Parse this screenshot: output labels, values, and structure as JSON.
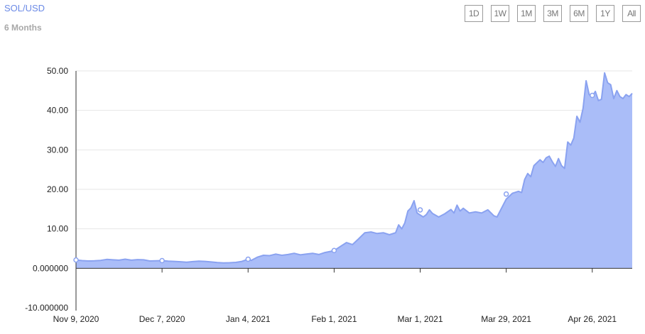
{
  "header": {
    "pair": "SOL/USD",
    "range_label": "6 Months"
  },
  "range_buttons": [
    "1D",
    "1W",
    "1M",
    "3M",
    "6M",
    "1Y",
    "All"
  ],
  "colors": {
    "line": "#8aa2f0",
    "area": "#aabdf8",
    "grid": "#e6e6e6",
    "title": "#6b8ae6"
  },
  "chart_data": {
    "type": "area",
    "title": "",
    "xlabel": "",
    "ylabel": "",
    "ylim": [
      -10,
      50
    ],
    "grid": true,
    "legend": "none",
    "xlim": [
      "2020-11-09",
      "2021-05-09"
    ],
    "x_ticks": [
      {
        "date": "2020-11-09",
        "label": "Nov 9, 2020"
      },
      {
        "date": "2020-12-07",
        "label": "Dec 7, 2020"
      },
      {
        "date": "2021-01-04",
        "label": "Jan 4, 2021"
      },
      {
        "date": "2021-02-01",
        "label": "Feb 1, 2021"
      },
      {
        "date": "2021-03-01",
        "label": "Mar 1, 2021"
      },
      {
        "date": "2021-03-29",
        "label": "Mar 29, 2021"
      },
      {
        "date": "2021-04-26",
        "label": "Apr 26, 2021"
      }
    ],
    "y_ticks": [
      {
        "value": 50,
        "label": "50.00"
      },
      {
        "value": 40,
        "label": "40.00"
      },
      {
        "value": 30,
        "label": "30.00"
      },
      {
        "value": 20,
        "label": "20.00"
      },
      {
        "value": 10,
        "label": "10.00"
      },
      {
        "value": 0,
        "label": "0.000000"
      },
      {
        "value": -10,
        "label": "-10.000000"
      }
    ],
    "series": [
      {
        "points": [
          [
            "2020-11-09",
            2.1
          ],
          [
            "2020-11-11",
            1.95
          ],
          [
            "2020-11-13",
            1.85
          ],
          [
            "2020-11-15",
            1.9
          ],
          [
            "2020-11-17",
            2.0
          ],
          [
            "2020-11-19",
            2.25
          ],
          [
            "2020-11-21",
            2.15
          ],
          [
            "2020-11-23",
            2.05
          ],
          [
            "2020-11-25",
            2.3
          ],
          [
            "2020-11-27",
            2.05
          ],
          [
            "2020-11-29",
            2.2
          ],
          [
            "2020-12-01",
            2.15
          ],
          [
            "2020-12-03",
            1.85
          ],
          [
            "2020-12-05",
            1.9
          ],
          [
            "2020-12-07",
            1.95
          ],
          [
            "2020-12-09",
            1.8
          ],
          [
            "2020-12-11",
            1.75
          ],
          [
            "2020-12-13",
            1.65
          ],
          [
            "2020-12-15",
            1.55
          ],
          [
            "2020-12-17",
            1.7
          ],
          [
            "2020-12-19",
            1.8
          ],
          [
            "2020-12-21",
            1.75
          ],
          [
            "2020-12-23",
            1.6
          ],
          [
            "2020-12-25",
            1.45
          ],
          [
            "2020-12-27",
            1.35
          ],
          [
            "2020-12-29",
            1.4
          ],
          [
            "2020-12-31",
            1.5
          ],
          [
            "2021-01-02",
            1.75
          ],
          [
            "2021-01-04",
            2.3
          ],
          [
            "2021-01-05",
            2.0
          ],
          [
            "2021-01-07",
            2.8
          ],
          [
            "2021-01-09",
            3.3
          ],
          [
            "2021-01-11",
            3.2
          ],
          [
            "2021-01-13",
            3.6
          ],
          [
            "2021-01-15",
            3.3
          ],
          [
            "2021-01-17",
            3.5
          ],
          [
            "2021-01-19",
            3.8
          ],
          [
            "2021-01-21",
            3.4
          ],
          [
            "2021-01-23",
            3.6
          ],
          [
            "2021-01-25",
            3.8
          ],
          [
            "2021-01-27",
            3.5
          ],
          [
            "2021-01-29",
            4.0
          ],
          [
            "2021-01-31",
            4.3
          ],
          [
            "2021-02-01",
            4.5
          ],
          [
            "2021-02-03",
            5.5
          ],
          [
            "2021-02-05",
            6.5
          ],
          [
            "2021-02-07",
            6.0
          ],
          [
            "2021-02-09",
            7.5
          ],
          [
            "2021-02-11",
            9.0
          ],
          [
            "2021-02-13",
            9.2
          ],
          [
            "2021-02-15",
            8.8
          ],
          [
            "2021-02-17",
            9.0
          ],
          [
            "2021-02-19",
            8.5
          ],
          [
            "2021-02-21",
            9.0
          ],
          [
            "2021-02-22",
            11.0
          ],
          [
            "2021-02-23",
            10.0
          ],
          [
            "2021-02-24",
            11.5
          ],
          [
            "2021-02-25",
            14.5
          ],
          [
            "2021-02-26",
            15.3
          ],
          [
            "2021-02-27",
            17.1
          ],
          [
            "2021-02-28",
            14.0
          ],
          [
            "2021-03-01",
            13.5
          ],
          [
            "2021-03-02",
            13.0
          ],
          [
            "2021-03-03",
            13.6
          ],
          [
            "2021-03-04",
            14.8
          ],
          [
            "2021-03-05",
            13.9
          ],
          [
            "2021-03-07",
            13.0
          ],
          [
            "2021-03-09",
            13.8
          ],
          [
            "2021-03-11",
            14.9
          ],
          [
            "2021-03-12",
            14.0
          ],
          [
            "2021-03-13",
            16.0
          ],
          [
            "2021-03-14",
            14.5
          ],
          [
            "2021-03-15",
            15.2
          ],
          [
            "2021-03-17",
            14.0
          ],
          [
            "2021-03-19",
            14.3
          ],
          [
            "2021-03-21",
            14.0
          ],
          [
            "2021-03-23",
            14.8
          ],
          [
            "2021-03-25",
            13.3
          ],
          [
            "2021-03-26",
            13.0
          ],
          [
            "2021-03-27",
            14.5
          ],
          [
            "2021-03-29",
            17.5
          ],
          [
            "2021-03-31",
            19.0
          ],
          [
            "2021-04-02",
            19.5
          ],
          [
            "2021-04-03",
            19.2
          ],
          [
            "2021-04-04",
            22.5
          ],
          [
            "2021-04-05",
            24.0
          ],
          [
            "2021-04-06",
            23.2
          ],
          [
            "2021-04-07",
            26.0
          ],
          [
            "2021-04-09",
            27.5
          ],
          [
            "2021-04-10",
            26.8
          ],
          [
            "2021-04-11",
            28.0
          ],
          [
            "2021-04-12",
            28.4
          ],
          [
            "2021-04-13",
            27.0
          ],
          [
            "2021-04-14",
            25.8
          ],
          [
            "2021-04-15",
            27.8
          ],
          [
            "2021-04-16",
            26.0
          ],
          [
            "2021-04-17",
            25.3
          ],
          [
            "2021-04-18",
            32.0
          ],
          [
            "2021-04-19",
            31.2
          ],
          [
            "2021-04-20",
            33.0
          ],
          [
            "2021-04-21",
            38.5
          ],
          [
            "2021-04-22",
            37.0
          ],
          [
            "2021-04-23",
            40.5
          ],
          [
            "2021-04-24",
            47.5
          ],
          [
            "2021-04-25",
            44.0
          ],
          [
            "2021-04-26",
            43.5
          ],
          [
            "2021-04-27",
            44.8
          ],
          [
            "2021-04-28",
            42.5
          ],
          [
            "2021-04-29",
            42.8
          ],
          [
            "2021-04-30",
            49.5
          ],
          [
            "2021-05-01",
            47.0
          ],
          [
            "2021-05-02",
            46.5
          ],
          [
            "2021-05-03",
            43.0
          ],
          [
            "2021-05-04",
            45.0
          ],
          [
            "2021-05-05",
            43.5
          ],
          [
            "2021-05-06",
            43.0
          ],
          [
            "2021-05-07",
            44.0
          ],
          [
            "2021-05-08",
            43.5
          ],
          [
            "2021-05-09",
            44.3
          ]
        ]
      }
    ],
    "markers": [
      [
        "2020-11-09",
        2.1
      ],
      [
        "2020-12-07",
        1.95
      ],
      [
        "2021-01-04",
        2.3
      ],
      [
        "2021-02-01",
        4.5
      ],
      [
        "2021-03-01",
        14.8
      ],
      [
        "2021-03-29",
        18.8
      ],
      [
        "2021-04-26",
        43.8
      ]
    ]
  }
}
